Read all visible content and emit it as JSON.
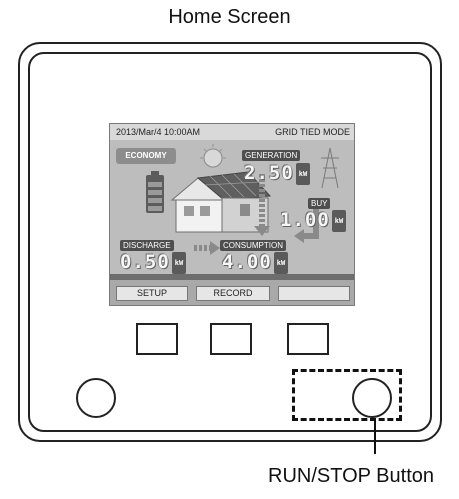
{
  "title": "Home Screen",
  "screen": {
    "datetime": "2013/Mar/4 10:00AM",
    "mode": "GRID TIED MODE",
    "economy": "ECONOMY",
    "generation": {
      "label": "GENERATION",
      "value": "2.50",
      "unit": "kW"
    },
    "buy": {
      "label": "BUY",
      "value": "1.00",
      "unit": "kW"
    },
    "discharge": {
      "label": "DISCHARGE",
      "value": "0.50",
      "unit": "kW"
    },
    "consumption": {
      "label": "CONSUMPTION",
      "value": "4.00",
      "unit": "kW"
    },
    "softkeys": {
      "setup": "SETUP",
      "record": "RECORD",
      "blank": ""
    }
  },
  "callout": {
    "run_stop": "RUN/STOP Button"
  },
  "colors": {
    "lcd_bg": "#bdbdbd",
    "label_bg": "#4e4e4e",
    "frame": "#222222"
  }
}
